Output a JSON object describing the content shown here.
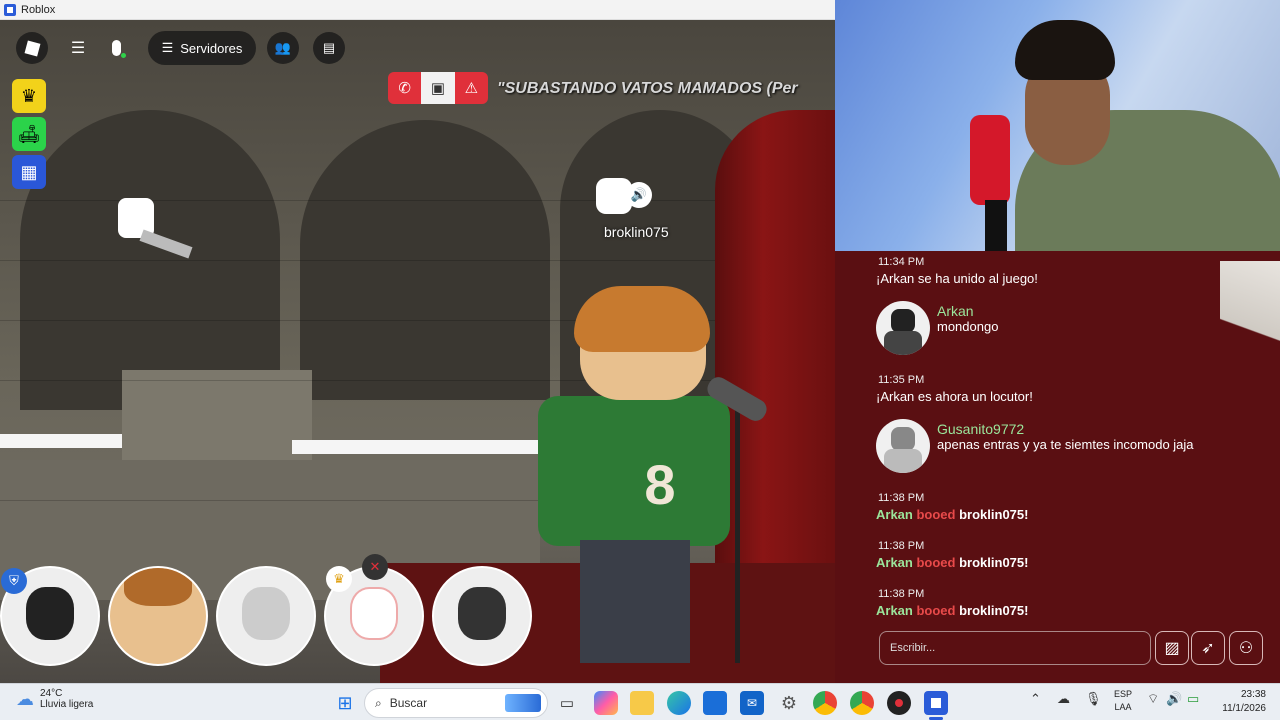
{
  "window": {
    "title": "Roblox"
  },
  "toolbar": {
    "servers_label": "Servidores",
    "servers_icon": "server-list-icon"
  },
  "banner": {
    "text": "\"SUBASTANDO VATOS MAMADOS (Per"
  },
  "player": {
    "name": "broklin075"
  },
  "chat": {
    "messages": [
      {
        "time": "11:34 PM",
        "system": "¡Arkan se ha unido al juego!"
      },
      {
        "name": "Arkan",
        "text": "mondongo"
      },
      {
        "time": "11:35 PM",
        "system": "¡Arkan es ahora un locutor!"
      },
      {
        "name": "Gusanito9772",
        "text": "apenas entras y ya te siemtes incomodo jaja"
      },
      {
        "time": "11:38 PM",
        "actor": "Arkan",
        "verb": "booed",
        "target": "broklin075!"
      },
      {
        "time": "11:38 PM",
        "actor": "Arkan",
        "verb": "booed",
        "target": "broklin075!"
      },
      {
        "time": "11:38 PM",
        "actor": "Arkan",
        "verb": "booed",
        "target": "broklin075!"
      }
    ],
    "input_placeholder": "Escribir..."
  },
  "colors": {
    "chat_bg": "#5a0f12",
    "name_green": "#9be59b",
    "boo_red": "#e84a4a",
    "call_red": "#e0303a"
  },
  "taskbar": {
    "weather_temp": "24°C",
    "weather_desc": "Lluvia ligera",
    "search_label": "Buscar",
    "lang_top": "ESP",
    "lang_bottom": "LAA",
    "time": "23:38",
    "date": "11/1/2026"
  }
}
